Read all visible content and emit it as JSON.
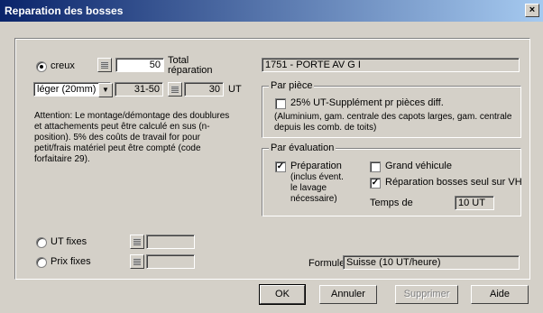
{
  "window": {
    "title": "Reparation des bosses",
    "close_label": "×"
  },
  "left": {
    "creux_label": "creux",
    "creux_value": "50",
    "total_label": "Total réparation",
    "severity_value": "léger (20mm)",
    "range_value": "31-50",
    "ut_value": "30",
    "ut_unit": "UT",
    "attention": "Attention: Le montage/démontage des doublures et attachements peut être calculé en sus (n-position). 5% des coûts de travail for pour petit/frais matériel peut être compté  (code forfaitaire 29)."
  },
  "part_field": "1751 - PORTE AV G I",
  "par_piece": {
    "title": "Par pièce",
    "check_label": "25% UT-Supplément pr pièces diff.",
    "note": "(Aluminium, gam. centrale des capots larges, gam. centrale depuis les comb. de toits)"
  },
  "par_evaluation": {
    "title": "Par évaluation",
    "preparation_label": "Préparation",
    "preparation_note": "(inclus évent. le lavage nécessaire)",
    "grand_vehicule_label": "Grand véhicule",
    "reparation_seul_label": "Réparation bosses seul sur VH",
    "temps_label": "Temps de",
    "temps_value": "10 UT"
  },
  "options": {
    "ut_fixes_label": "UT fixes",
    "prix_fixes_label": "Prix fixes",
    "ut_fixes_value": "",
    "prix_fixes_value": ""
  },
  "formule": {
    "label": "Formule",
    "value": "Suisse (10 UT/heure)"
  },
  "buttons": {
    "ok": "OK",
    "annuler": "Annuler",
    "supprimer": "Supprimer",
    "aide": "Aide"
  }
}
